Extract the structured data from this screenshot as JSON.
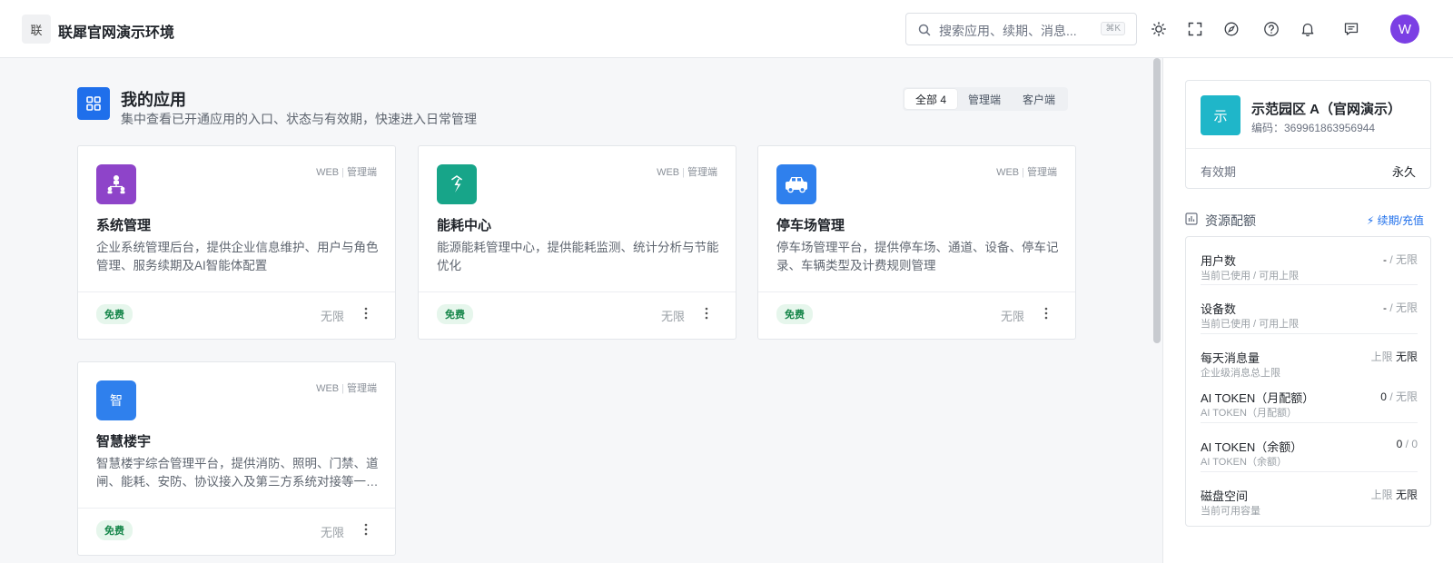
{
  "header": {
    "logo_text": "联",
    "app_title": "联犀官网演示环境",
    "search_placeholder": "搜索应用、续期、消息...",
    "search_shortcut": "⌘K",
    "avatar_letter": "W",
    "avatar_color": "#7b3fe4"
  },
  "main": {
    "title": "我的应用",
    "subtitle": "集中查看已开通应用的入口、状态与有效期，快速进入日常管理",
    "tabs": [
      "全部 4",
      "管理端",
      "客户端"
    ],
    "cards": [
      {
        "title": "系统管理",
        "tag_platform": "WEB",
        "tag_type": "管理端",
        "desc": "企业系统管理后台，提供企业信息维护、用户与角色管理、服务续期及AI智能体配置",
        "badge": "免费",
        "limit": "无限",
        "icon": "org-chart-icon",
        "color": "#8e44c9"
      },
      {
        "title": "能耗中心",
        "tag_platform": "WEB",
        "tag_type": "管理端",
        "desc": "能源能耗管理中心，提供能耗监测、统计分析与节能优化",
        "badge": "免费",
        "limit": "无限",
        "icon": "energy-icon",
        "color": "#17a589"
      },
      {
        "title": "停车场管理",
        "tag_platform": "WEB",
        "tag_type": "管理端",
        "desc": "停车场管理平台，提供停车场、通道、设备、停车记录、车辆类型及计费规则管理",
        "badge": "免费",
        "limit": "无限",
        "icon": "car-icon",
        "color": "#2f80ed"
      },
      {
        "title": "智慧楼宇",
        "tag_platform": "WEB",
        "tag_type": "管理端",
        "desc": "智慧楼宇综合管理平台，提供消防、照明、门禁、道闸、能耗、安防、协议接入及第三方系统对接等一…",
        "badge": "免费",
        "limit": "无限",
        "icon_text": "智",
        "color": "#2f80ed"
      }
    ]
  },
  "org": {
    "logo_text": "示",
    "name": "示范园区 A（官网演示）",
    "code": "编码：369961863956944",
    "validity_label": "有效期",
    "validity_value": "永久"
  },
  "resources": {
    "title": "资源配额",
    "link": "续期/充值",
    "rows": [
      {
        "name": "用户数",
        "sub": "当前已使用 / 可用上限",
        "used": "-",
        "limit": " / 无限"
      },
      {
        "name": "设备数",
        "sub": "当前已使用 / 可用上限",
        "used": "-",
        "limit": " / 无限"
      },
      {
        "name": "每天消息量",
        "sub": "企业级消息总上限",
        "prefix": "上限",
        "value": "无限"
      },
      {
        "name": "AI TOKEN（月配额）",
        "sub": "AI TOKEN（月配额）",
        "used": "0",
        "limit": " / 无限"
      },
      {
        "name": "AI TOKEN（余额）",
        "sub": "AI TOKEN（余额）",
        "used": "0",
        "limit": " / 0"
      },
      {
        "name": "磁盘空间",
        "sub": "当前可用容量",
        "prefix": "上限",
        "value": "无限"
      }
    ]
  }
}
